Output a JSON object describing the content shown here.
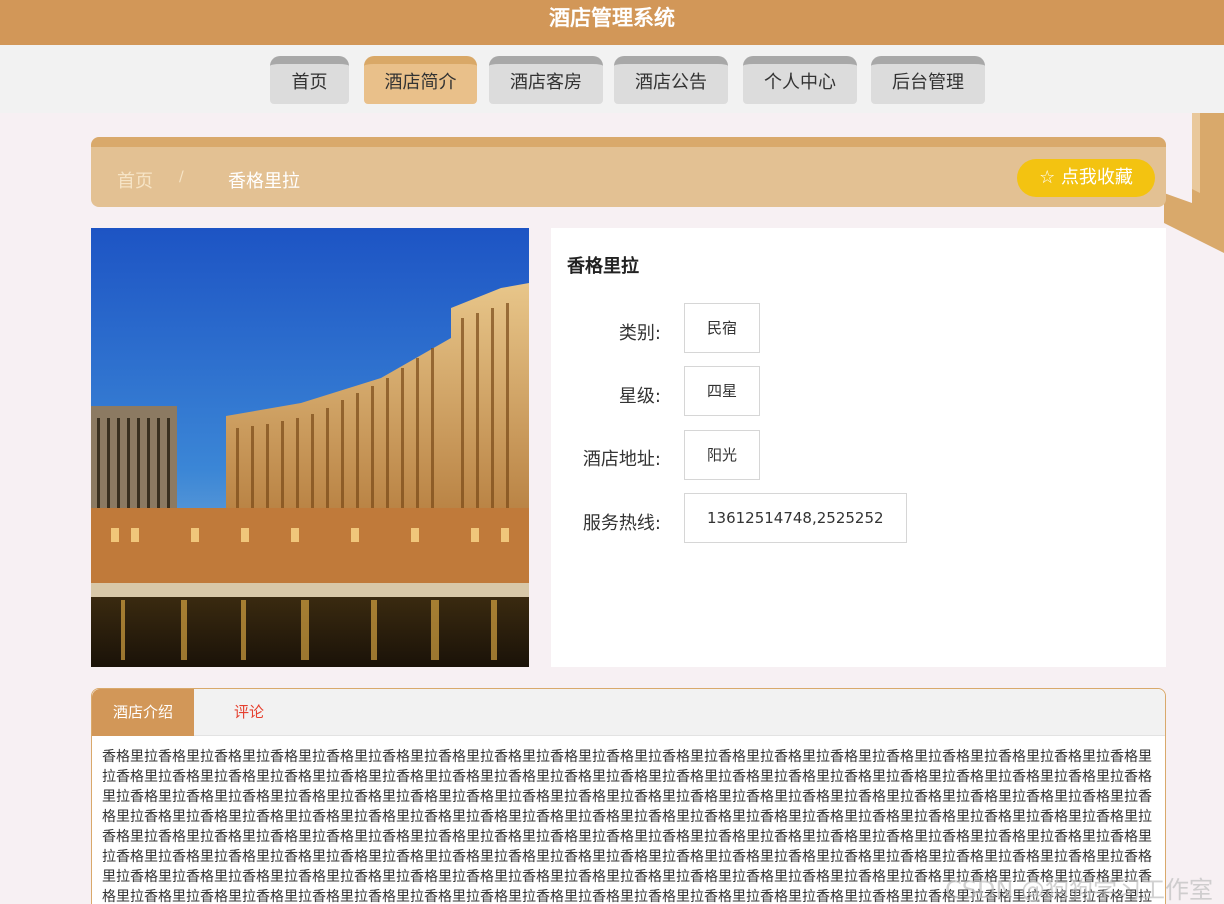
{
  "header": {
    "title": "酒店管理系统"
  },
  "nav": {
    "items": [
      {
        "label": "首页"
      },
      {
        "label": "酒店简介",
        "active": true
      },
      {
        "label": "酒店客房"
      },
      {
        "label": "酒店公告"
      },
      {
        "label": "个人中心"
      },
      {
        "label": "后台管理"
      }
    ]
  },
  "breadcrumb": {
    "home": "首页",
    "separator": "/",
    "current": "香格里拉"
  },
  "favorite_button": {
    "icon": "star-outline-icon",
    "label": "点我收藏"
  },
  "hotel": {
    "name": "香格里拉",
    "fields": [
      {
        "label": "类别:",
        "value": "民宿"
      },
      {
        "label": "星级:",
        "value": "四星"
      },
      {
        "label": "酒店地址:",
        "value": "阳光"
      },
      {
        "label": "服务热线:",
        "value": "13612514748,2525252"
      }
    ]
  },
  "tabs": {
    "intro_label": "酒店介绍",
    "comments_label": "评论",
    "intro_text": "香格里拉香格里拉香格里拉香格里拉香格里拉香格里拉香格里拉香格里拉香格里拉香格里拉香格里拉香格里拉香格里拉香格里拉香格里拉香格里拉香格里拉香格里拉香格里拉香格里拉香格里拉香格里拉香格里拉香格里拉香格里拉香格里拉香格里拉香格里拉香格里拉香格里拉香格里拉香格里拉香格里拉香格里拉香格里拉香格里拉香格里拉香格里拉香格里拉香格里拉香格里拉香格里拉香格里拉香格里拉香格里拉香格里拉香格里拉香格里拉香格里拉香格里拉香格里拉香格里拉香格里拉香格里拉香格里拉香格里拉香格里拉香格里拉香格里拉香格里拉香格里拉香格里拉香格里拉香格里拉香格里拉香格里拉香格里拉香格里拉香格里拉香格里拉香格里拉香格里拉香格里拉香格里拉香格里拉香格里拉香格里拉香格里拉香格里拉香格里拉香格里拉香格里拉香格里拉香格里拉香格里拉香格里拉香格里拉香格里拉香格里拉香格里拉香格里拉香格里拉香格里拉香格里拉香格里拉香格里拉香格里拉香格里拉香格里拉香格里拉香格里拉香格里拉香格里拉香格里拉香格里拉香格里拉香格里拉香格里拉香格里拉香格里拉香格里拉香格里拉香格里拉香格里拉香格里拉香格里拉香格里拉香格里拉香格里拉香格里拉香格里拉香格里拉香格里拉香格里拉香格里拉香格里拉香格里拉香格里拉香格里拉香格里拉香格里拉香格里拉香格里拉香格里拉香格里拉香格里拉香格里拉香格里拉香格里拉香格里拉香格里拉香格里拉香格里拉香格里拉香格里拉香格里拉香格里拉香格里拉香格里拉香格里拉香格里拉是是香格里拉香格里拉香格里拉香格里拉香格里拉香格里拉香格里拉香格里拉香格里拉香格里拉香格里拉香格里拉香格里拉香格里拉香格里拉香格里拉香格里拉香格里拉香格里拉香格里拉香格里拉香格里拉香格里拉香格里拉香格里拉香格里拉香格里拉香格里拉香格里拉香格里拉香格里拉香格里拉香格里拉"
  },
  "watermark": "CSDN @狗狗学习工作室",
  "colors": {
    "header": "#d29758",
    "active_tab": "#e9c08a",
    "favorite": "#f3c311",
    "comment_tab": "#e6402f"
  }
}
